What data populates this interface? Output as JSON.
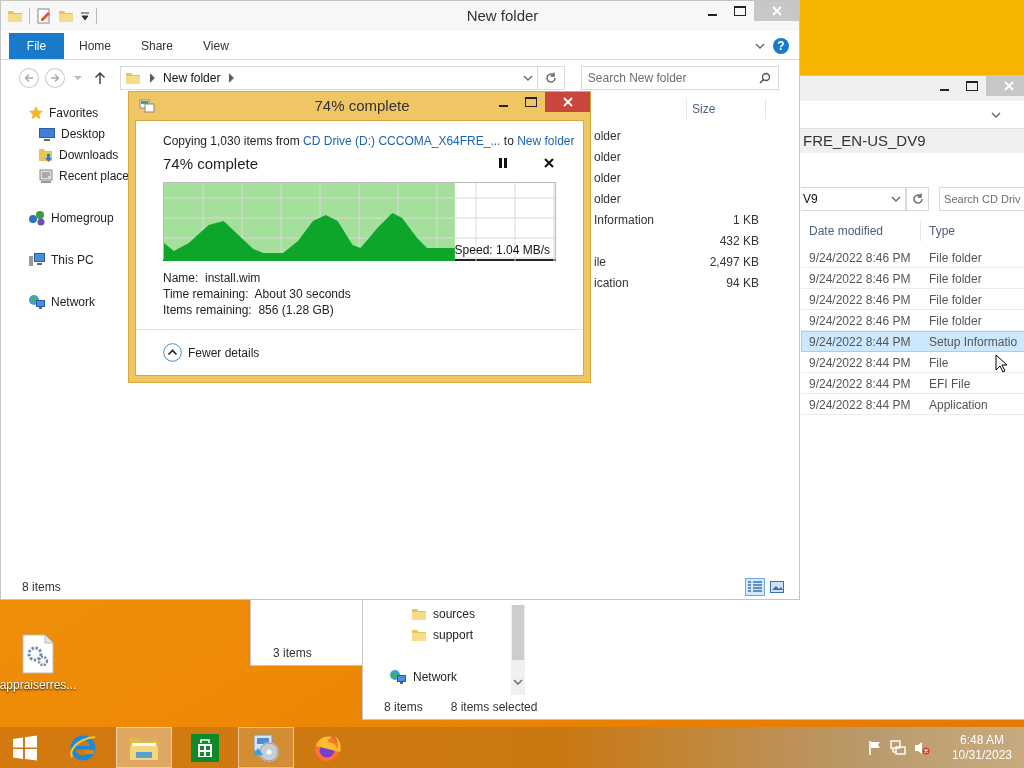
{
  "main_window": {
    "title": "New folder",
    "tabs": [
      {
        "label": "File",
        "selected": true
      },
      {
        "label": "Home",
        "selected": false
      },
      {
        "label": "Share",
        "selected": false
      },
      {
        "label": "View",
        "selected": false
      }
    ],
    "help_button": "?",
    "breadcrumb": [
      "New folder"
    ],
    "search": {
      "placeholder": "Search New folder"
    },
    "nav": [
      {
        "label": "Favorites",
        "kind": "star",
        "children": [
          {
            "label": "Desktop",
            "kind": "desktop"
          },
          {
            "label": "Downloads",
            "kind": "downloads"
          },
          {
            "label": "Recent place",
            "kind": "recent"
          }
        ]
      },
      {
        "label": "Homegroup",
        "kind": "homegroup"
      },
      {
        "label": "This PC",
        "kind": "pc"
      },
      {
        "label": "Network",
        "kind": "network"
      }
    ],
    "size_header": "Size",
    "rows": [
      {
        "type": "older",
        "size": ""
      },
      {
        "type": "older",
        "size": ""
      },
      {
        "type": "older",
        "size": ""
      },
      {
        "type": "older",
        "size": ""
      },
      {
        "type": "Information",
        "size": "1 KB"
      },
      {
        "type": "",
        "size": "432 KB"
      },
      {
        "type": "ile",
        "size": "2,497 KB"
      },
      {
        "type": "ication",
        "size": "94 KB"
      }
    ],
    "status": "8 items",
    "view_buttons": [
      {
        "kind": "details",
        "selected": true
      },
      {
        "kind": "tiles",
        "selected": false
      }
    ]
  },
  "dialog": {
    "title": "74% complete",
    "copy_line": {
      "prefix": "Copying 1,030 items from",
      "source": "CD Drive (D:) CCCOMA_X64FRE_...",
      "middle": "to",
      "destination": "New folder"
    },
    "heading": "74% complete",
    "progress": {
      "level": 0.74,
      "speed": "Speed: 1.04 MB/s"
    },
    "details": [
      {
        "label": "Name:",
        "value": "install.wim"
      },
      {
        "label": "Time remaining:",
        "value": "About 30 seconds"
      },
      {
        "label": "Items remaining:",
        "value": "856 (1.28 GB)"
      }
    ],
    "toggle": "Fewer details"
  },
  "cd_window": {
    "title_fragment": "FRE_EN-US_DV9",
    "address": "V9",
    "search": {
      "placeholder": "Search CD Driv"
    },
    "columns": [
      "Date modified",
      "Type"
    ],
    "rows": [
      {
        "date": "9/24/2022 8:46 PM",
        "type": "File folder",
        "selected": false
      },
      {
        "date": "9/24/2022 8:46 PM",
        "type": "File folder",
        "selected": false
      },
      {
        "date": "9/24/2022 8:46 PM",
        "type": "File folder",
        "selected": false
      },
      {
        "date": "9/24/2022 8:46 PM",
        "type": "File folder",
        "selected": false
      },
      {
        "date": "9/24/2022 8:44 PM",
        "type": "Setup Informatio",
        "selected": true
      },
      {
        "date": "9/24/2022 8:44 PM",
        "type": "File",
        "selected": false
      },
      {
        "date": "9/24/2022 8:44 PM",
        "type": "EFI File",
        "selected": false
      },
      {
        "date": "9/24/2022 8:44 PM",
        "type": "Application",
        "selected": false
      }
    ],
    "nav": [
      {
        "label": "sources",
        "kind": "folder"
      },
      {
        "label": "support",
        "kind": "folder"
      },
      {
        "label": "Network",
        "kind": "network"
      }
    ],
    "status": [
      "8 items",
      "8 items selected"
    ]
  },
  "third_window": {
    "status": "3 items"
  },
  "desktop_icons": [
    {
      "label": "appraiserres..."
    }
  ],
  "taskbar": {
    "apps": [
      {
        "kind": "start",
        "open": false,
        "selected": false
      },
      {
        "kind": "ie",
        "open": false,
        "selected": false
      },
      {
        "kind": "explorer",
        "open": true,
        "selected": true
      },
      {
        "kind": "store",
        "open": false,
        "selected": false
      },
      {
        "kind": "setup",
        "open": true,
        "selected": false
      },
      {
        "kind": "firefox",
        "open": false,
        "selected": false
      }
    ],
    "tray": [
      {
        "kind": "flag"
      },
      {
        "kind": "network"
      },
      {
        "kind": "volume-muted"
      }
    ],
    "time": "6:48 AM",
    "date": "10/31/2023"
  }
}
